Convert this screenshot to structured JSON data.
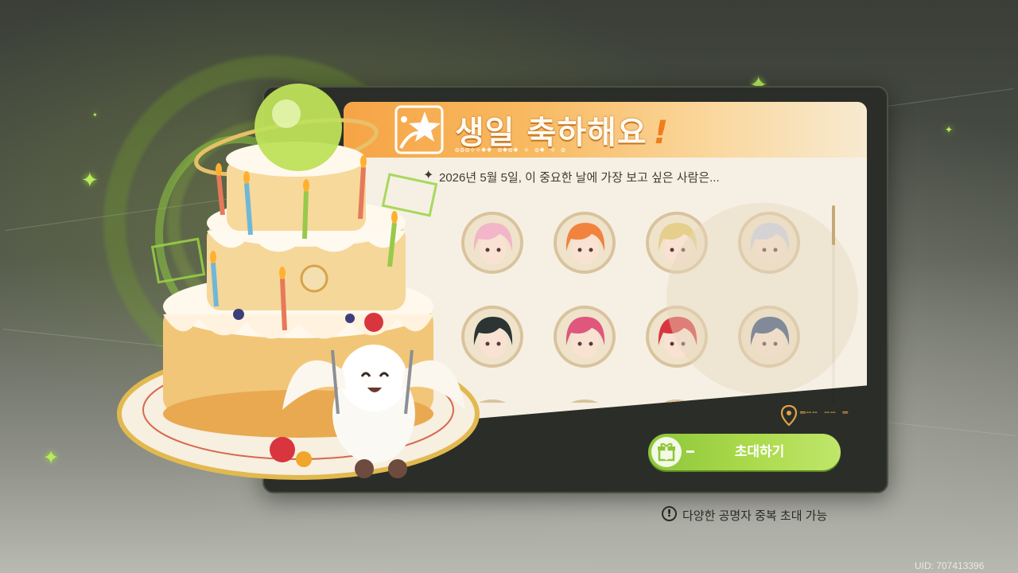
{
  "header": {
    "title": "생일 축하해요",
    "title_mark": "!",
    "decoration": "❂❂❂⟡⟡⬥⬥ ❂⬥❂⬥ ⟡ ❂⬥ ⟡ ❂"
  },
  "prompt": {
    "text": "2026년 5월 5일, 이 중요한 날에 가장 보고 싶은 사람은..."
  },
  "avatars": [
    {
      "name": "pink-haired-girl-avatar",
      "hair": "#f2b6c8"
    },
    {
      "name": "orange-haired-girl-avatar",
      "hair": "#f2833f"
    },
    {
      "name": "blonde-boy-avatar",
      "hair": "#e6cf8d"
    },
    {
      "name": "silver-haired-girl-avatar",
      "hair": "#c8cfe6"
    },
    {
      "name": "dark-haired-man-avatar",
      "hair": "#2c3434"
    },
    {
      "name": "pink-twin-tail-girl-avatar",
      "hair": "#e0577e"
    },
    {
      "name": "red-horned-girl-avatar",
      "hair": "#d7363f"
    },
    {
      "name": "blue-hat-boy-avatar",
      "hair": "#2e4a79"
    },
    {
      "name": "grey-haired-avatar",
      "hair": "#6a6a6a"
    },
    {
      "name": "black-haired-avatar",
      "hair": "#2a2423"
    },
    {
      "name": "white-haired-avatar",
      "hair": "#d9d9d9"
    },
    {
      "name": "blue-spiky-avatar",
      "hair": "#3a6f9a"
    }
  ],
  "actions": {
    "invite_label": "초대하기"
  },
  "notice": {
    "text": "다양한 공명자 중복 초대 가능"
  },
  "footer": {
    "uid": "UID: 707413396"
  },
  "colors": {
    "accent_orange": "#f6a445",
    "accent_green": "#a9d94a",
    "panel_dark": "#2b2e28",
    "paper": "#f6f0e4"
  }
}
